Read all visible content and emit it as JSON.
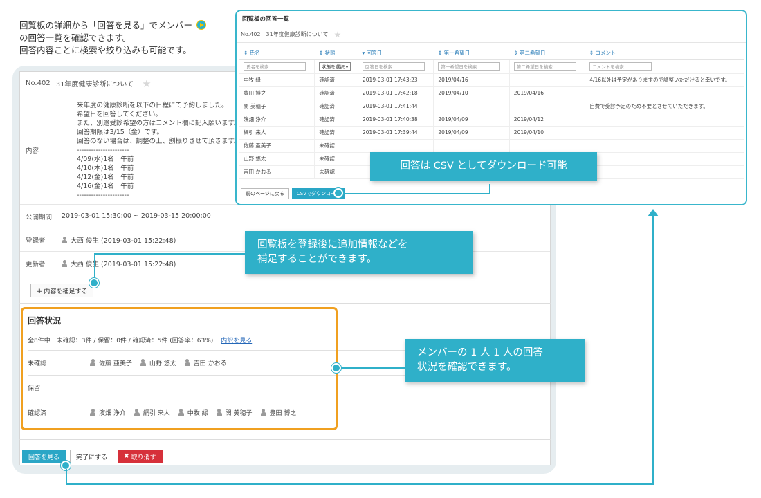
{
  "intro": {
    "line1": "回覧板の詳細から「回答を見る」でメンバー",
    "line2": "の回答一覧を確認できます。",
    "line3": "回答内容ことに検索や絞り込みも可能です。"
  },
  "detail": {
    "number": "No.402",
    "title": "31年度健康診断について",
    "content_label": "内容",
    "content_lines": [
      "来年度の健康診断を以下の日程にて予約しました。",
      "希望日を回答してください。",
      "また、別途受診希望の方はコメント欄に記入願います。",
      "回答期限は3/15（金）です。",
      "回答のない場合は、調整の上、割振りさせて頂きます。",
      "----------------------",
      "4/09(水)1名　午前",
      "4/10(木)1名　午前",
      "4/12(金)1名　午前",
      "4/16(金)1名　午前",
      "----------------------"
    ],
    "period_label": "公開期間",
    "period_value": "2019-03-01 15:30:00 ~ 2019-03-15 20:00:00",
    "registrant_label": "登録者",
    "registrant_value": "大西 俊生 (2019-03-01 15:22:48)",
    "updater_label": "更新者",
    "updater_value": "大西 俊生 (2019-03-01 15:22:48)",
    "supplement_button": "✚ 内容を補足する"
  },
  "status": {
    "title": "回答状況",
    "summary": "全8件中　未確認：3件 / 保留：0件 / 確認済：5件 (回答率：63%)",
    "summary_link": "内訳を見る",
    "rows": [
      {
        "label": "未確認",
        "people": [
          "佐藤 亜美子",
          "山野 悠太",
          "吉田 かおる"
        ]
      },
      {
        "label": "保留",
        "people": []
      },
      {
        "label": "確認済",
        "people": [
          "濱畑 浄介",
          "網引 来人",
          "中牧 緑",
          "関 美穂子",
          "豊田 博之"
        ]
      }
    ]
  },
  "actions": {
    "view_answers": "回答を見る",
    "complete": "完了にする",
    "cancel": "取り消す"
  },
  "answers": {
    "window_title": "回覧板の回答一覧",
    "subtitle": "No.402　31年度健康診断について",
    "columns": [
      "⇕ 氏名",
      "⇕ 状態",
      "▾ 回答日",
      "⇕ 第一希望日",
      "⇕ 第二希望日",
      "⇕ コメント"
    ],
    "filters": [
      "氏名を検索",
      "状態を選択 ▾",
      "回答日を検索",
      "第一希望日を検索",
      "第二希望日を検索",
      "コメントを検索"
    ],
    "rows": [
      [
        "中牧 緑",
        "確認済",
        "2019-03-01 17:43:23",
        "2019/04/16",
        "",
        "4/16以外は予定がありますので調整いただけると幸いです。"
      ],
      [
        "豊田 博之",
        "確認済",
        "2019-03-01 17:42:18",
        "2019/04/10",
        "2019/04/16",
        ""
      ],
      [
        "関 美穂子",
        "確認済",
        "2019-03-01 17:41:44",
        "",
        "",
        "自費で受診予定のため不要とさせていただきます。"
      ],
      [
        "濱畑 浄介",
        "確認済",
        "2019-03-01 17:40:38",
        "2019/04/09",
        "2019/04/12",
        ""
      ],
      [
        "網引 来人",
        "確認済",
        "2019-03-01 17:39:44",
        "2019/04/09",
        "2019/04/10",
        ""
      ],
      [
        "佐藤 亜美子",
        "未確認",
        "",
        "",
        "",
        ""
      ],
      [
        "山野 悠太",
        "未確認",
        "",
        "",
        "",
        ""
      ],
      [
        "吉田 かおる",
        "未確認",
        "",
        "",
        "",
        ""
      ]
    ],
    "back_button": "前のページに戻る",
    "csv_button": "CSVでダウンロード"
  },
  "callouts": {
    "csv": "回答は CSV としてダウンロード可能",
    "supplement_line1": "回覧板を登録後に追加情報などを",
    "supplement_line2": "補足することができます。",
    "status_line1": "メンバーの 1 人 1 人の回答",
    "status_line2": "状況を確認できます。"
  },
  "colors": {
    "accent": "#2fb0c9",
    "highlight": "#f0a020",
    "danger": "#d6303a"
  }
}
